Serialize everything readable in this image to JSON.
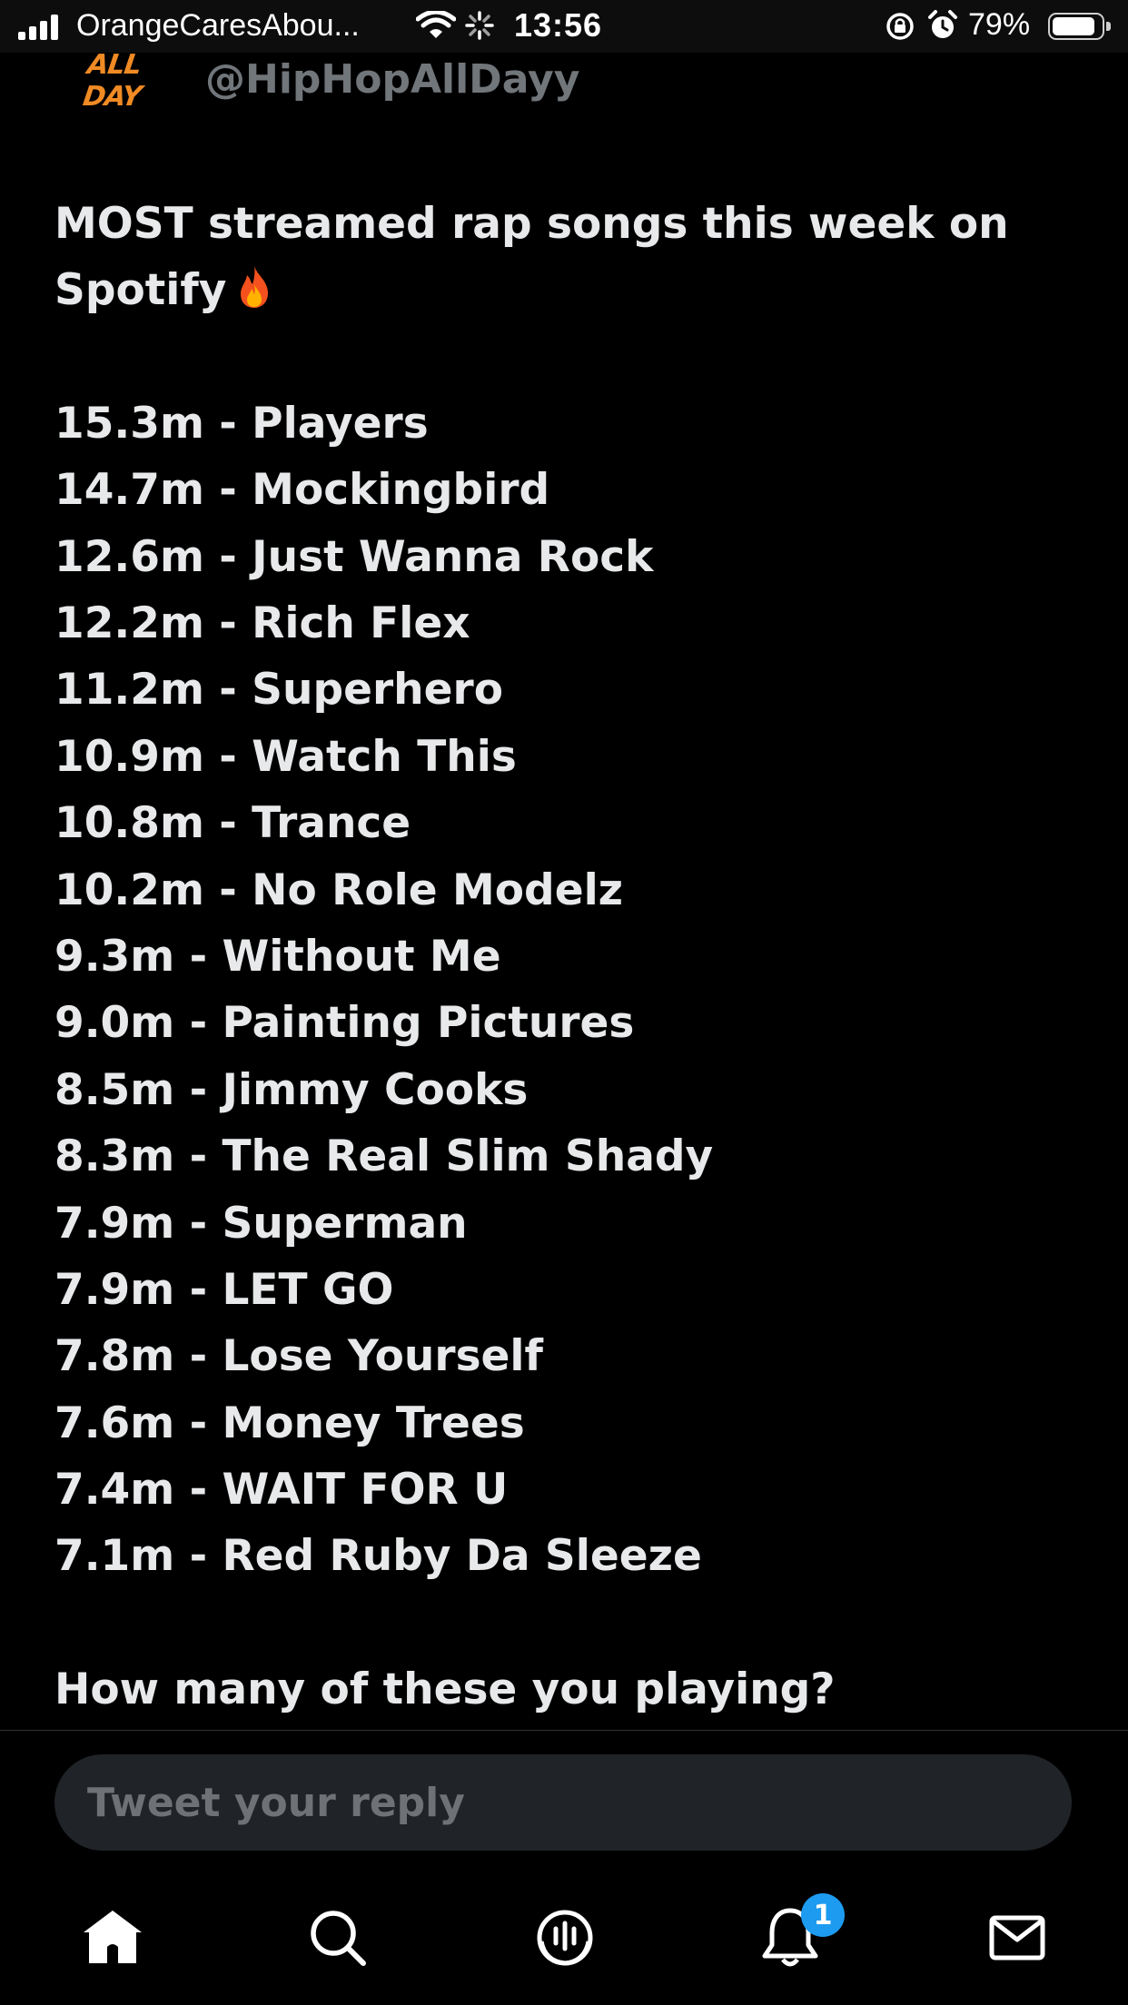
{
  "status_bar": {
    "carrier": "OrangeCaresAbou...",
    "time": "13:56",
    "battery_percent": "79%",
    "battery_level": 0.79
  },
  "tweet": {
    "author_handle": "@HipHopAllDayy",
    "avatar_text": "ALL DAY",
    "headline": "MOST streamed rap songs this week on Spotify",
    "headline_emoji": "fire-icon",
    "songs": [
      "15.3m - Players",
      "14.7m - Mockingbird",
      "12.6m - Just Wanna Rock",
      "12.2m - Rich Flex",
      "11.2m - Superhero",
      "10.9m - Watch This",
      "10.8m - Trance",
      "10.2m - No Role Modelz",
      "9.3m - Without Me",
      "9.0m - Painting Pictures",
      "8.5m - Jimmy Cooks",
      "8.3m - The Real Slim Shady",
      "7.9m - Superman",
      "7.9m - LET GO",
      "7.8m - Lose Yourself",
      "7.6m - Money Trees",
      "7.4m - WAIT FOR U",
      "7.1m - Red Ruby Da Sleeze"
    ],
    "question": "How many of these you playing?"
  },
  "reply": {
    "placeholder": "Tweet your reply"
  },
  "tab_bar": {
    "items": [
      "home-icon",
      "search-icon",
      "spaces-icon",
      "notifications-icon",
      "messages-icon"
    ],
    "notifications_badge": "1"
  },
  "colors": {
    "background": "#000000",
    "text": "#e7e9ea",
    "muted": "#71767b",
    "accent": "#1d9bf0"
  }
}
